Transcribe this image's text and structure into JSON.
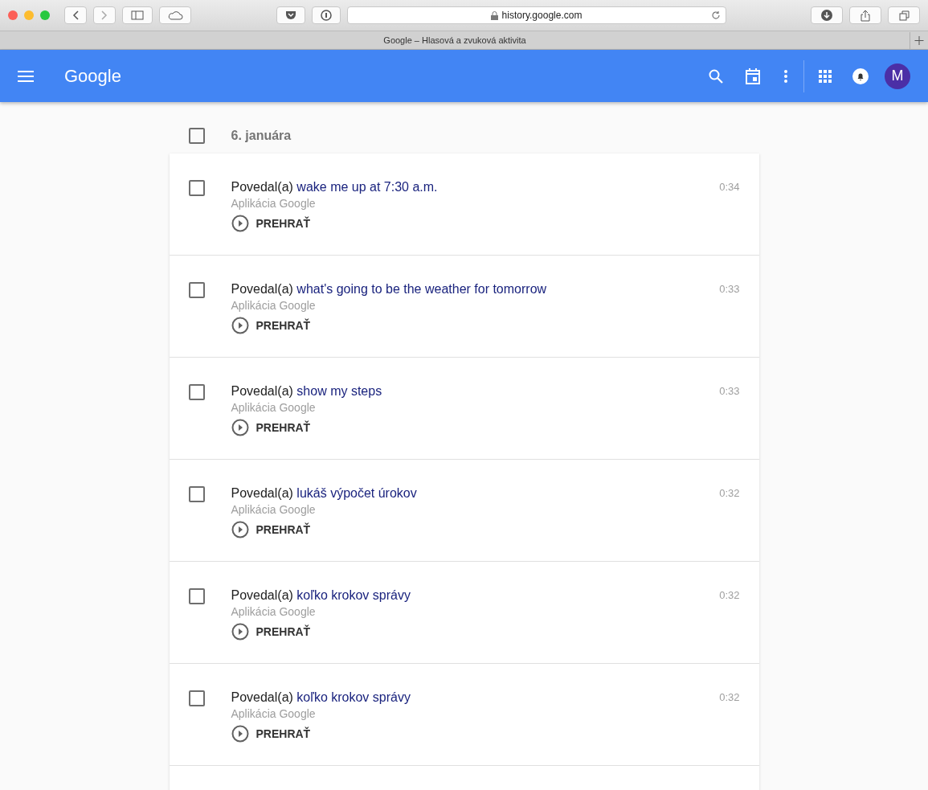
{
  "browser": {
    "address": "history.google.com",
    "tab_title": "Google – Hlasová a zvuková aktivita"
  },
  "header": {
    "logo": "Google",
    "avatar_letter": "M"
  },
  "date_group": {
    "label": "6. januára",
    "checked": false
  },
  "items": [
    {
      "prefix": "Povedal(a)",
      "query": "wake me up at 7:30 a.m.",
      "source": "Aplikácia Google",
      "time": "0:34",
      "play": "PREHRAŤ",
      "checked": false
    },
    {
      "prefix": "Povedal(a)",
      "query": "what's going to be the weather for tomorrow",
      "source": "Aplikácia Google",
      "time": "0:33",
      "play": "PREHRAŤ",
      "checked": false
    },
    {
      "prefix": "Povedal(a)",
      "query": "show my steps",
      "source": "Aplikácia Google",
      "time": "0:33",
      "play": "PREHRAŤ",
      "checked": false
    },
    {
      "prefix": "Povedal(a)",
      "query": "lukáš výpočet úrokov",
      "source": "Aplikácia Google",
      "time": "0:32",
      "play": "PREHRAŤ",
      "checked": false
    },
    {
      "prefix": "Povedal(a)",
      "query": "koľko krokov správy",
      "source": "Aplikácia Google",
      "time": "0:32",
      "play": "PREHRAŤ",
      "checked": false
    },
    {
      "prefix": "Povedal(a)",
      "query": "koľko krokov správy",
      "source": "Aplikácia Google",
      "time": "0:32",
      "play": "PREHRAŤ",
      "checked": false
    }
  ]
}
